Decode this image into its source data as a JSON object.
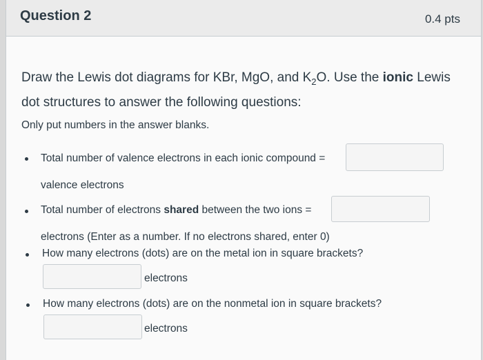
{
  "header": {
    "title": "Question 2",
    "points": "0.4 pts"
  },
  "question": {
    "prompt_part1": "Draw the Lewis dot diagrams for KBr, MgO, and K",
    "prompt_sub": "2",
    "prompt_part2": "O.  Use the ",
    "prompt_bold": "ionic",
    "prompt_part3": " Lewis dot structures to answer the following questions:",
    "note": "Only put numbers in the answer blanks."
  },
  "items": [
    {
      "text_before": "Total number of valence electrons in each ionic compound =",
      "text_after": "valence electrons",
      "answer": ""
    },
    {
      "text_before_1": "Total number of electrons ",
      "text_bold": "shared",
      "text_before_2": " between the two ions =",
      "text_after": "electrons (Enter as a number. If no electrons shared, enter 0)",
      "answer": ""
    },
    {
      "text_before": "How many electrons (dots) are on the metal ion in square brackets?",
      "text_after": "electrons",
      "answer": ""
    },
    {
      "text_before": "How many electrons (dots) are on the nonmetal ion in square brackets?",
      "text_after": "electrons",
      "answer": ""
    }
  ]
}
